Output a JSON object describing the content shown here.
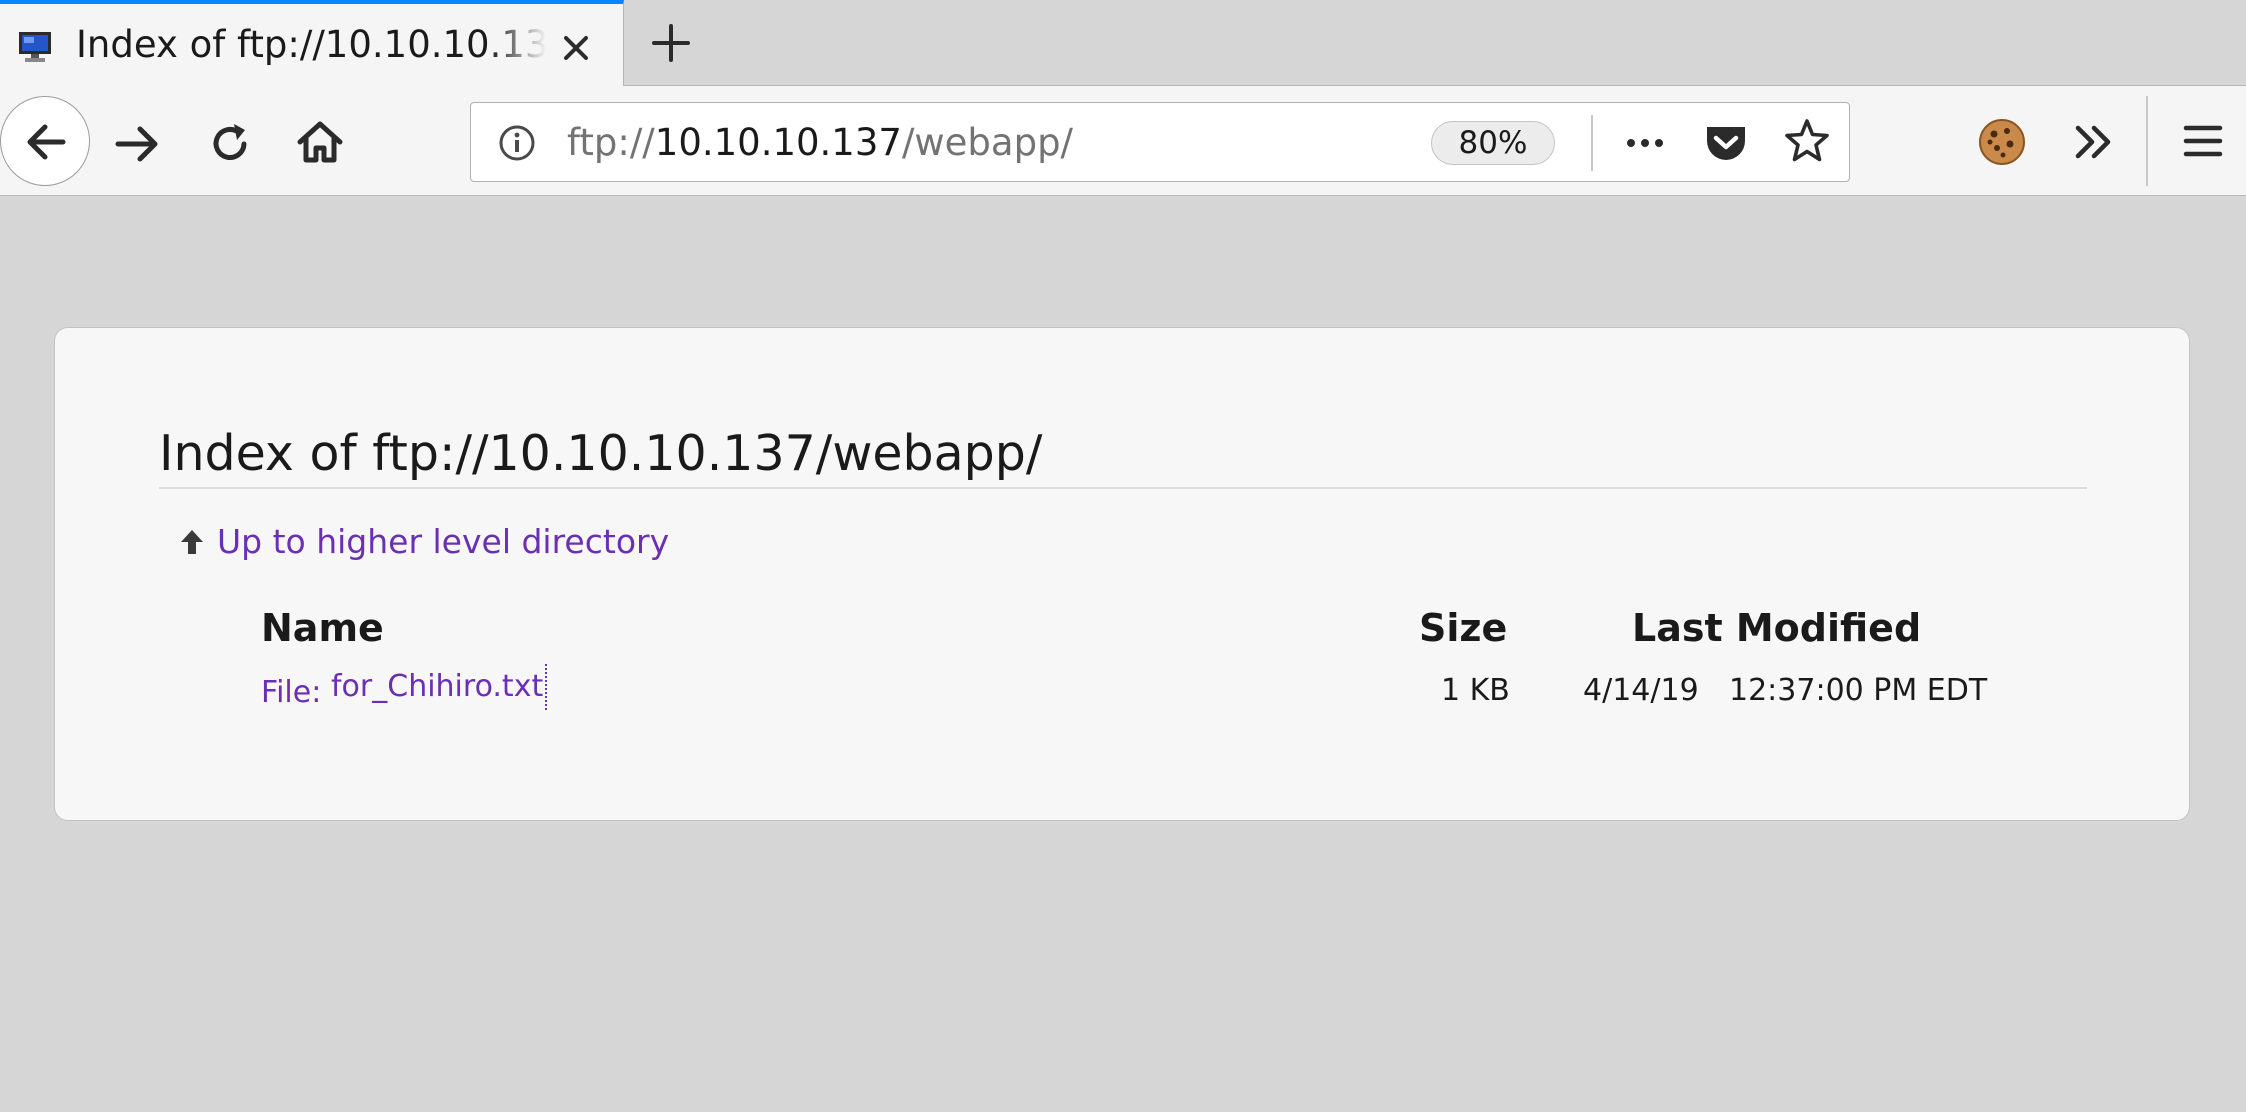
{
  "browser": {
    "tab": {
      "title": "Index of ftp://10.10.10.137/webapp/",
      "favicon": "computer-monitor-icon"
    },
    "toolbar": {
      "url_scheme": "ftp://",
      "url_host": "10.10.10.137",
      "url_path": "/webapp/",
      "zoom": "80%",
      "icons": [
        "back-arrow-icon",
        "forward-arrow-icon",
        "reload-icon",
        "home-icon",
        "info-icon",
        "more-actions-icon",
        "pocket-icon",
        "star-icon",
        "cookie-icon",
        "overflow-chevron-icon",
        "hamburger-menu-icon"
      ]
    },
    "accent_color": "#0a84ff"
  },
  "page": {
    "heading": "Index of ftp://10.10.10.137/webapp/",
    "up_link": "Up to higher level directory",
    "link_color": "#6b2fb3",
    "columns": {
      "name": "Name",
      "size": "Size",
      "modified": "Last Modified"
    },
    "files": [
      {
        "prefix": "File:",
        "name": "for_Chihiro.txt",
        "size": "1 KB",
        "date": "4/14/19",
        "time": "12:37:00 PM EDT"
      }
    ]
  }
}
